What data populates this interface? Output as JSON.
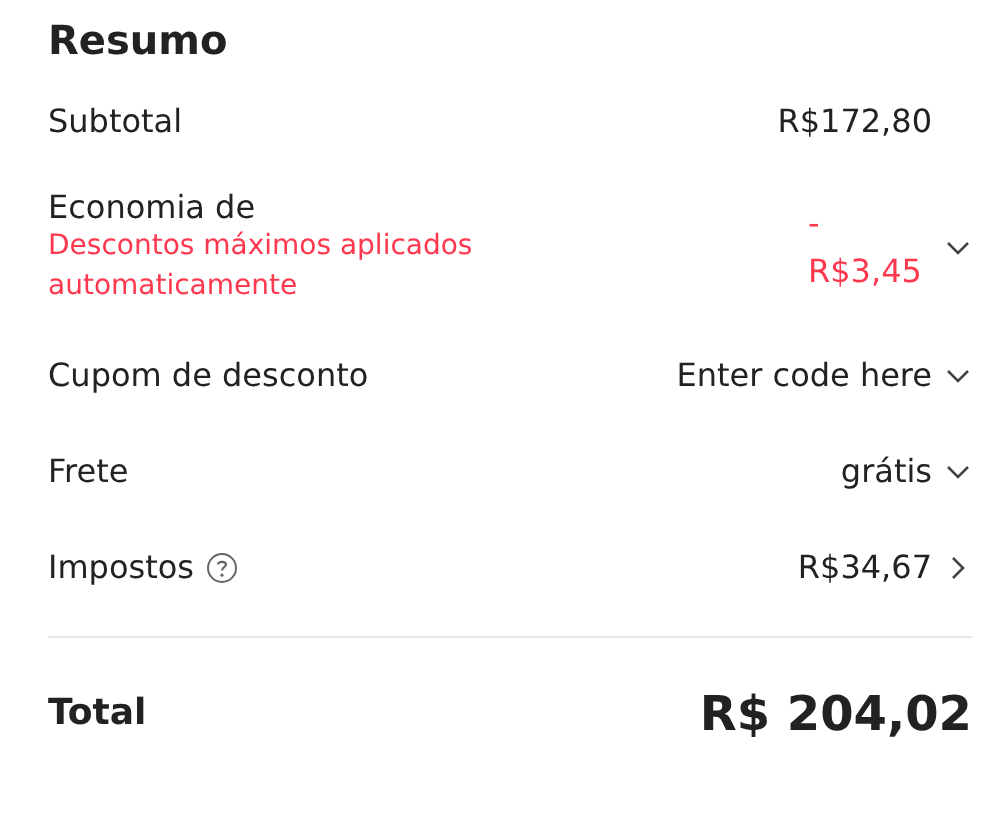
{
  "title": "Resumo",
  "rows": [
    {
      "kind": "plain",
      "label": "Subtotal",
      "value": "R$172,80"
    },
    {
      "kind": "discount",
      "label": "Economia de",
      "note": "Descontos máximos aplicados automaticamente",
      "value": "- R$3,45",
      "expanded": false
    },
    {
      "kind": "plain",
      "label": "Cupom de desconto",
      "value": "Enter code here",
      "expanded": false
    },
    {
      "kind": "plain",
      "label": "Frete",
      "value": "grátis",
      "expanded": false
    },
    {
      "kind": "plain",
      "label": "Impostos",
      "help": true,
      "value": "R$34,67",
      "navigable": true
    }
  ],
  "total": {
    "label": "Total",
    "value": "R$ 204,02"
  }
}
